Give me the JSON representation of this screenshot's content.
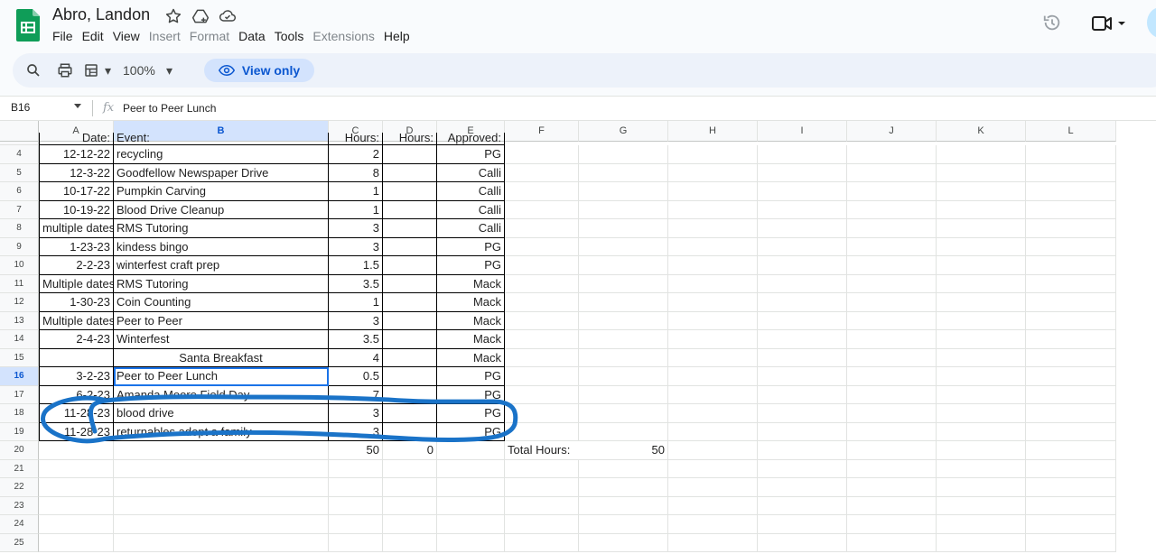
{
  "app": {
    "doc_title": "Abro, Landon",
    "menu": [
      "File",
      "Edit",
      "View",
      "Insert",
      "Format",
      "Data",
      "Tools",
      "Extensions",
      "Help"
    ],
    "menu_disabled": [
      "Insert",
      "Format",
      "Extensions"
    ]
  },
  "toolbar": {
    "zoom": "100%",
    "view_only_label": "View only"
  },
  "formula_bar": {
    "cell_ref": "B16",
    "content": "Peer to Peer Lunch"
  },
  "sheet": {
    "columns": [
      "A",
      "B",
      "C",
      "D",
      "E",
      "F",
      "G",
      "H",
      "I",
      "J",
      "K",
      "L"
    ],
    "selected_column": "B",
    "selected_row": "16",
    "partial_row": {
      "row": "3",
      "cells": [
        "Date:",
        "Event:",
        "Hours:",
        "Hours:",
        "Approved:"
      ]
    },
    "rows": [
      {
        "row": "4",
        "cells": [
          "12-12-22",
          "recycling",
          "2",
          "",
          "PG"
        ]
      },
      {
        "row": "5",
        "cells": [
          "12-3-22",
          "Goodfellow Newspaper Drive",
          "8",
          "",
          "Calli"
        ]
      },
      {
        "row": "6",
        "cells": [
          "10-17-22",
          "Pumpkin Carving",
          "1",
          "",
          "Calli"
        ]
      },
      {
        "row": "7",
        "cells": [
          "10-19-22",
          "Blood Drive Cleanup",
          "1",
          "",
          "Calli"
        ]
      },
      {
        "row": "8",
        "cells": [
          "multiple dates",
          "RMS Tutoring",
          "3",
          "",
          "Calli"
        ]
      },
      {
        "row": "9",
        "cells": [
          "1-23-23",
          "kindess bingo",
          "3",
          "",
          "PG"
        ]
      },
      {
        "row": "10",
        "cells": [
          "2-2-23",
          "winterfest craft prep",
          "1.5",
          "",
          "PG"
        ]
      },
      {
        "row": "11",
        "cells": [
          "Multiple dates",
          "RMS Tutoring",
          "3.5",
          "",
          "Mack"
        ]
      },
      {
        "row": "12",
        "cells": [
          "1-30-23",
          "Coin Counting",
          "1",
          "",
          "Mack"
        ]
      },
      {
        "row": "13",
        "cells": [
          "Multiple dates",
          "Peer to Peer",
          "3",
          "",
          "Mack"
        ]
      },
      {
        "row": "14",
        "cells": [
          "2-4-23",
          "Winterfest",
          "3.5",
          "",
          "Mack"
        ]
      },
      {
        "row": "15",
        "cells": [
          "",
          "Santa Breakfast",
          "4",
          "",
          "Mack"
        ]
      },
      {
        "row": "16",
        "cells": [
          "3-2-23",
          "Peer to Peer Lunch",
          "0.5",
          "",
          "PG"
        ]
      },
      {
        "row": "17",
        "cells": [
          "6-2-23",
          "Amanda Moore Field Day",
          "7",
          "",
          "PG"
        ]
      },
      {
        "row": "18",
        "cells": [
          "11-28-23",
          "blood drive",
          "3",
          "",
          "PG"
        ]
      },
      {
        "row": "19",
        "cells": [
          "11-28-23",
          "returnables adopt a family",
          "3",
          "",
          "PG"
        ]
      }
    ],
    "totals_row": {
      "row": "20",
      "c": "50",
      "d": "0",
      "f_label": "Total Hours:",
      "g_value": "50"
    },
    "empty_rows": [
      "21",
      "22",
      "23",
      "24",
      "25"
    ]
  },
  "annotation": {
    "color": "#1a73c8"
  }
}
